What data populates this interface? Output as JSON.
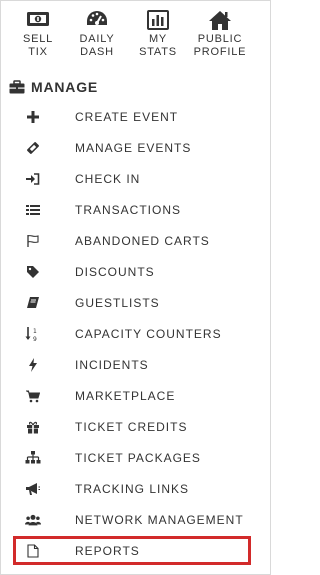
{
  "quick_links": [
    {
      "line1": "SELL",
      "line2": "TIX",
      "icon": "money-icon"
    },
    {
      "line1": "DAILY",
      "line2": "DASH",
      "icon": "dashboard-icon"
    },
    {
      "line1": "MY",
      "line2": "STATS",
      "icon": "bar-chart-icon"
    },
    {
      "line1": "PUBLIC",
      "line2": "PROFILE",
      "icon": "home-icon"
    }
  ],
  "section": {
    "title": "MANAGE",
    "icon": "briefcase-icon"
  },
  "menu": [
    {
      "label": "CREATE EVENT",
      "icon": "plus-icon"
    },
    {
      "label": "MANAGE EVENTS",
      "icon": "ticket-icon"
    },
    {
      "label": "CHECK IN",
      "icon": "sign-in-icon"
    },
    {
      "label": "TRANSACTIONS",
      "icon": "list-icon"
    },
    {
      "label": "ABANDONED CARTS",
      "icon": "flag-outline-icon"
    },
    {
      "label": "DISCOUNTS",
      "icon": "tag-icon"
    },
    {
      "label": "GUESTLISTS",
      "icon": "book-icon"
    },
    {
      "label": "CAPACITY COUNTERS",
      "icon": "sort-numeric-icon"
    },
    {
      "label": "INCIDENTS",
      "icon": "bolt-icon"
    },
    {
      "label": "MARKETPLACE",
      "icon": "cart-icon"
    },
    {
      "label": "TICKET CREDITS",
      "icon": "gift-icon"
    },
    {
      "label": "TICKET PACKAGES",
      "icon": "sitemap-icon"
    },
    {
      "label": "TRACKING LINKS",
      "icon": "bullhorn-icon"
    },
    {
      "label": "NETWORK MANAGEMENT",
      "icon": "users-icon"
    },
    {
      "label": "REPORTS",
      "icon": "file-outline-icon"
    }
  ],
  "colors": {
    "highlight": "#d22a2a",
    "text": "#333333"
  }
}
